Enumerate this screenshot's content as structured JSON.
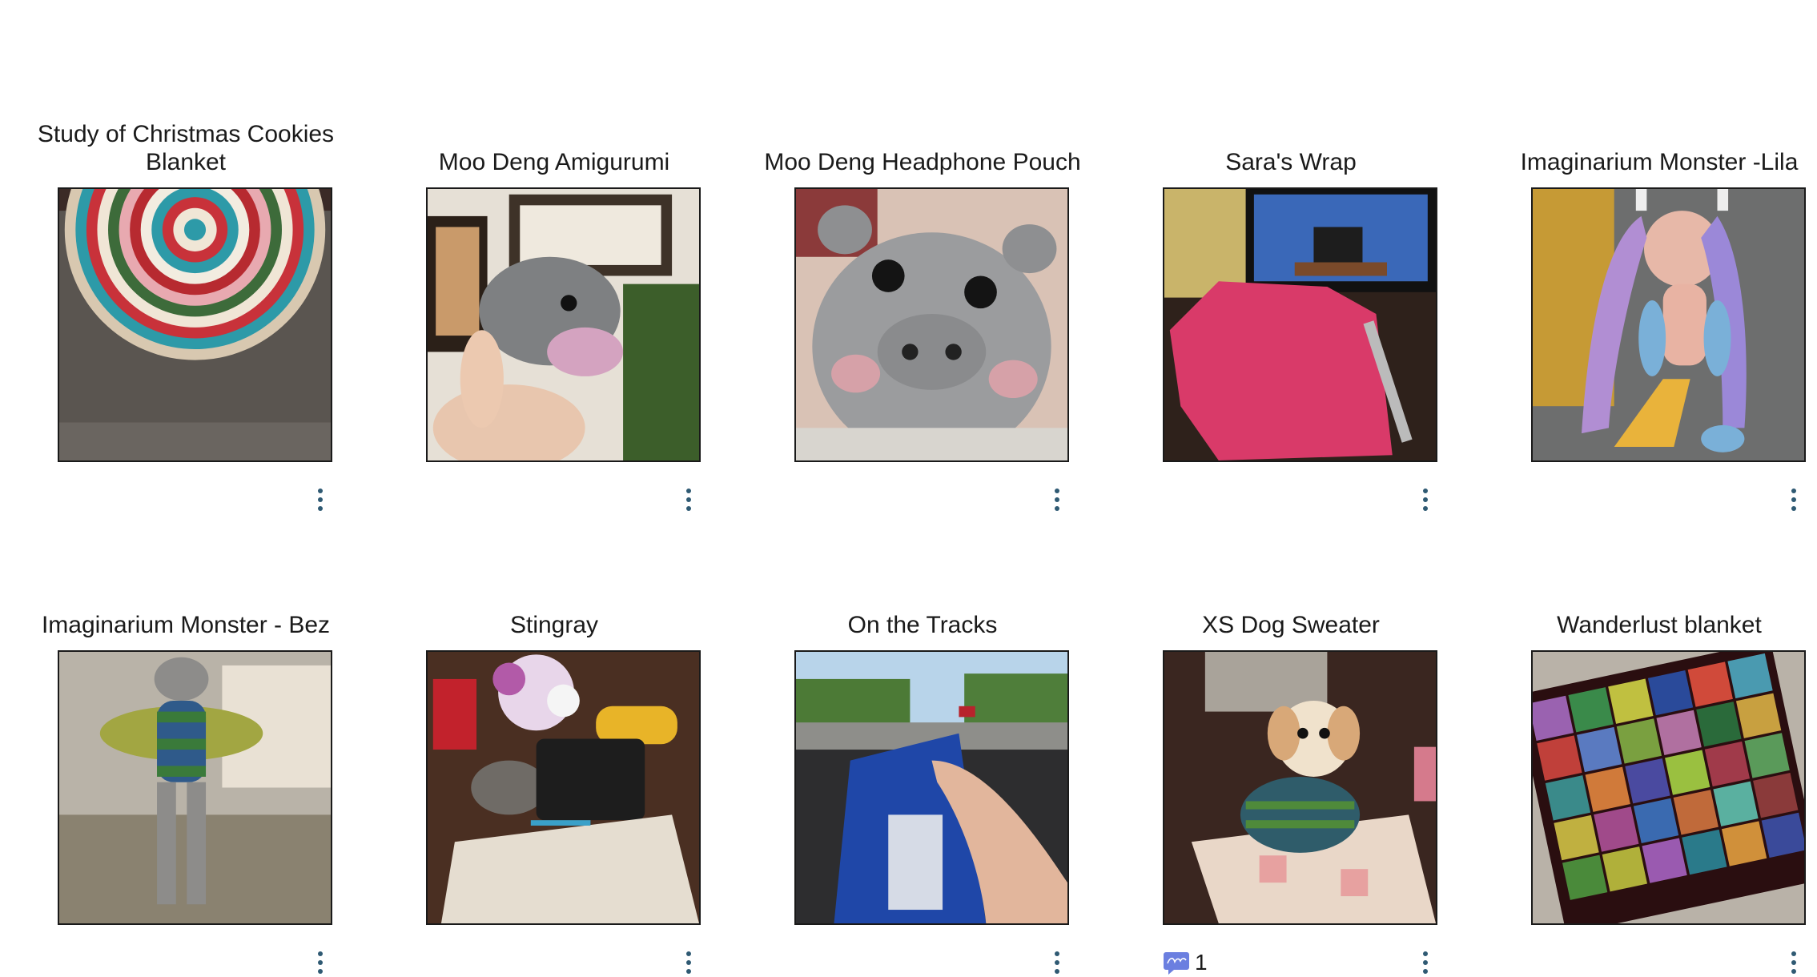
{
  "projects": [
    {
      "title": "Study of Christmas Cookies Blanket",
      "image": "crochet-round-blanket-photo",
      "menu_icon": "more-vertical-icon"
    },
    {
      "title": "Moo Deng Amigurumi",
      "image": "crochet-hippo-photo",
      "menu_icon": "more-vertical-icon"
    },
    {
      "title": "Moo Deng Headphone Pouch",
      "image": "crochet-hippo-face-pouch-photo",
      "menu_icon": "more-vertical-icon"
    },
    {
      "title": "Sara's Wrap",
      "image": "pink-knit-wrap-photo",
      "menu_icon": "more-vertical-icon"
    },
    {
      "title": "Imaginarium Monster -Lila",
      "image": "crochet-doll-photo",
      "menu_icon": "more-vertical-icon"
    },
    {
      "title": "Imaginarium Monster - Bez",
      "image": "crochet-monster-photo",
      "menu_icon": "more-vertical-icon"
    },
    {
      "title": "Stingray",
      "image": "crochet-shawl-photo",
      "menu_icon": "more-vertical-icon"
    },
    {
      "title": "On the Tracks",
      "image": "knitting-in-car-photo",
      "menu_icon": "more-vertical-icon"
    },
    {
      "title": "XS Dog Sweater",
      "image": "dog-in-sweater-photo",
      "menu_icon": "more-vertical-icon",
      "comment_count": "1",
      "comment_icon": "comment-icon"
    },
    {
      "title": "Wanderlust blanket",
      "image": "granny-square-blanket-photo",
      "menu_icon": "more-vertical-icon"
    }
  ],
  "colors": {
    "menu_dots": "#2f5a73",
    "comment_badge": "#6b7fe0",
    "thumb_border": "#1a1a1a"
  }
}
